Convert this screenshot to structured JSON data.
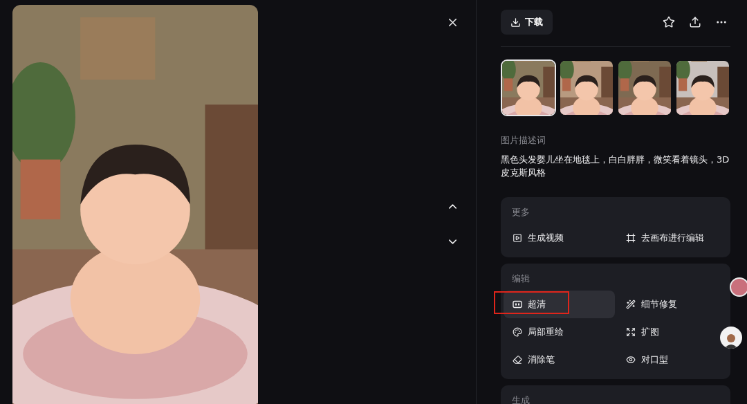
{
  "toolbar": {
    "download_button": "下载"
  },
  "thumbnails": [
    {
      "selected": true
    },
    {
      "selected": false
    },
    {
      "selected": false
    },
    {
      "selected": false
    }
  ],
  "prompt": {
    "label": "图片描述词",
    "text": "黑色头发婴儿坐在地毯上，白白胖胖，微笑看着镜头，3D皮克斯风格"
  },
  "sections": [
    {
      "title": "更多",
      "items": [
        {
          "label": "生成视频",
          "kind": "video",
          "selected": false,
          "outlined": false
        },
        {
          "label": "去画布进行编辑",
          "kind": "canvas",
          "selected": false,
          "outlined": false
        }
      ]
    },
    {
      "title": "编辑",
      "items": [
        {
          "label": "超清",
          "kind": "hd",
          "selected": true,
          "outlined": true
        },
        {
          "label": "细节修复",
          "kind": "repair",
          "selected": false,
          "outlined": false
        },
        {
          "label": "局部重绘",
          "kind": "inpaint",
          "selected": false,
          "outlined": false
        },
        {
          "label": "扩图",
          "kind": "expand",
          "selected": false,
          "outlined": false
        },
        {
          "label": "消除笔",
          "kind": "eraser",
          "selected": false,
          "outlined": false
        },
        {
          "label": "对口型",
          "kind": "lipsync",
          "selected": false,
          "outlined": false
        }
      ]
    },
    {
      "title": "生成"
    }
  ]
}
